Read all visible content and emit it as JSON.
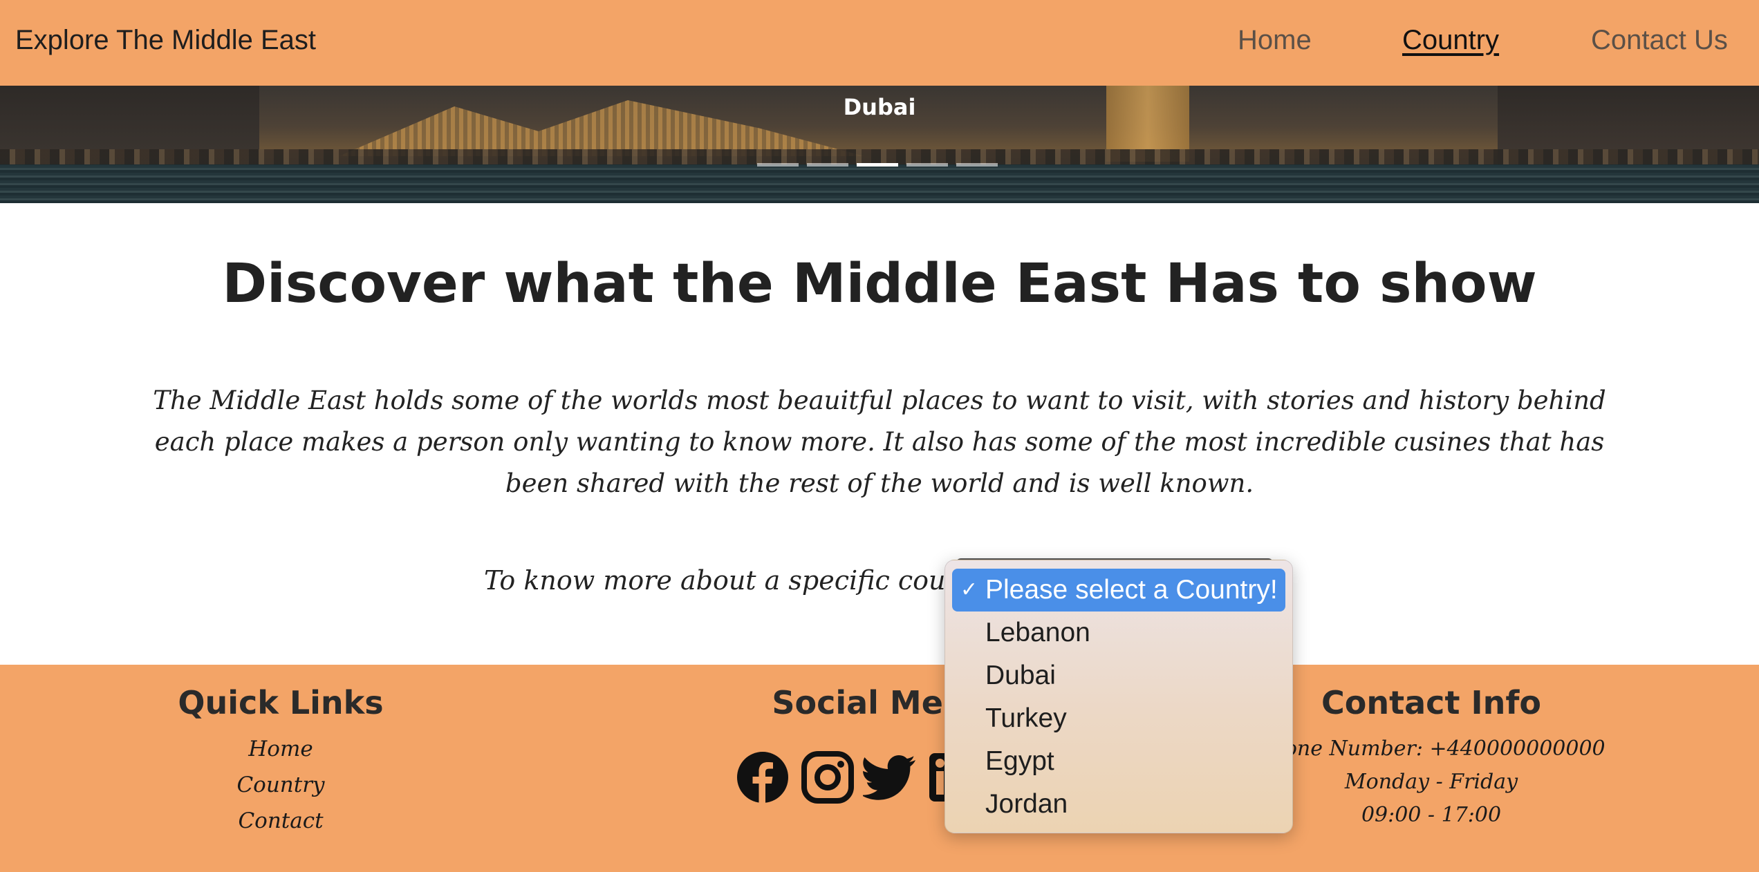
{
  "navbar": {
    "brand": "Explore The Middle East",
    "links": [
      "Home",
      "Country",
      "Contact Us"
    ],
    "active": "Country"
  },
  "carousel": {
    "caption": "Dubai",
    "slide_count": 5,
    "active_slide": 3
  },
  "main": {
    "heading": "Discover what the Middle East Has to show",
    "intro": "The Middle East holds some of the worlds most beauitful places to want to visit, with stories and history behind each place makes a person only wanting to know more. It also has some of the most incredible cusines that has been shared with the rest of the world and is well known.",
    "prompt": "To know more about a specific country,"
  },
  "country_select": {
    "options": [
      {
        "label": "Please select a Country!",
        "selected": true
      },
      {
        "label": "Lebanon",
        "selected": false
      },
      {
        "label": "Dubai",
        "selected": false
      },
      {
        "label": "Turkey",
        "selected": false
      },
      {
        "label": "Egypt",
        "selected": false
      },
      {
        "label": "Jordan",
        "selected": false
      }
    ],
    "check_mark": "✓",
    "highlight_color": "#4a8fe8"
  },
  "footer": {
    "quick_links": {
      "title": "Quick Links",
      "links": [
        "Home",
        "Country",
        "Contact"
      ]
    },
    "social_media": {
      "title": "Social Media",
      "icons": [
        "facebook-icon",
        "instagram-icon",
        "twitter-icon",
        "linkedin-icon"
      ]
    },
    "contact_info": {
      "title": "Contact Info",
      "phone": "Phone Number: +440000000000",
      "days": "Monday - Friday",
      "hours": "09:00 - 17:00"
    }
  },
  "colors": {
    "navbar_bg": "#f3a467",
    "footer_bg": "#f3a467",
    "text": "#222222"
  }
}
